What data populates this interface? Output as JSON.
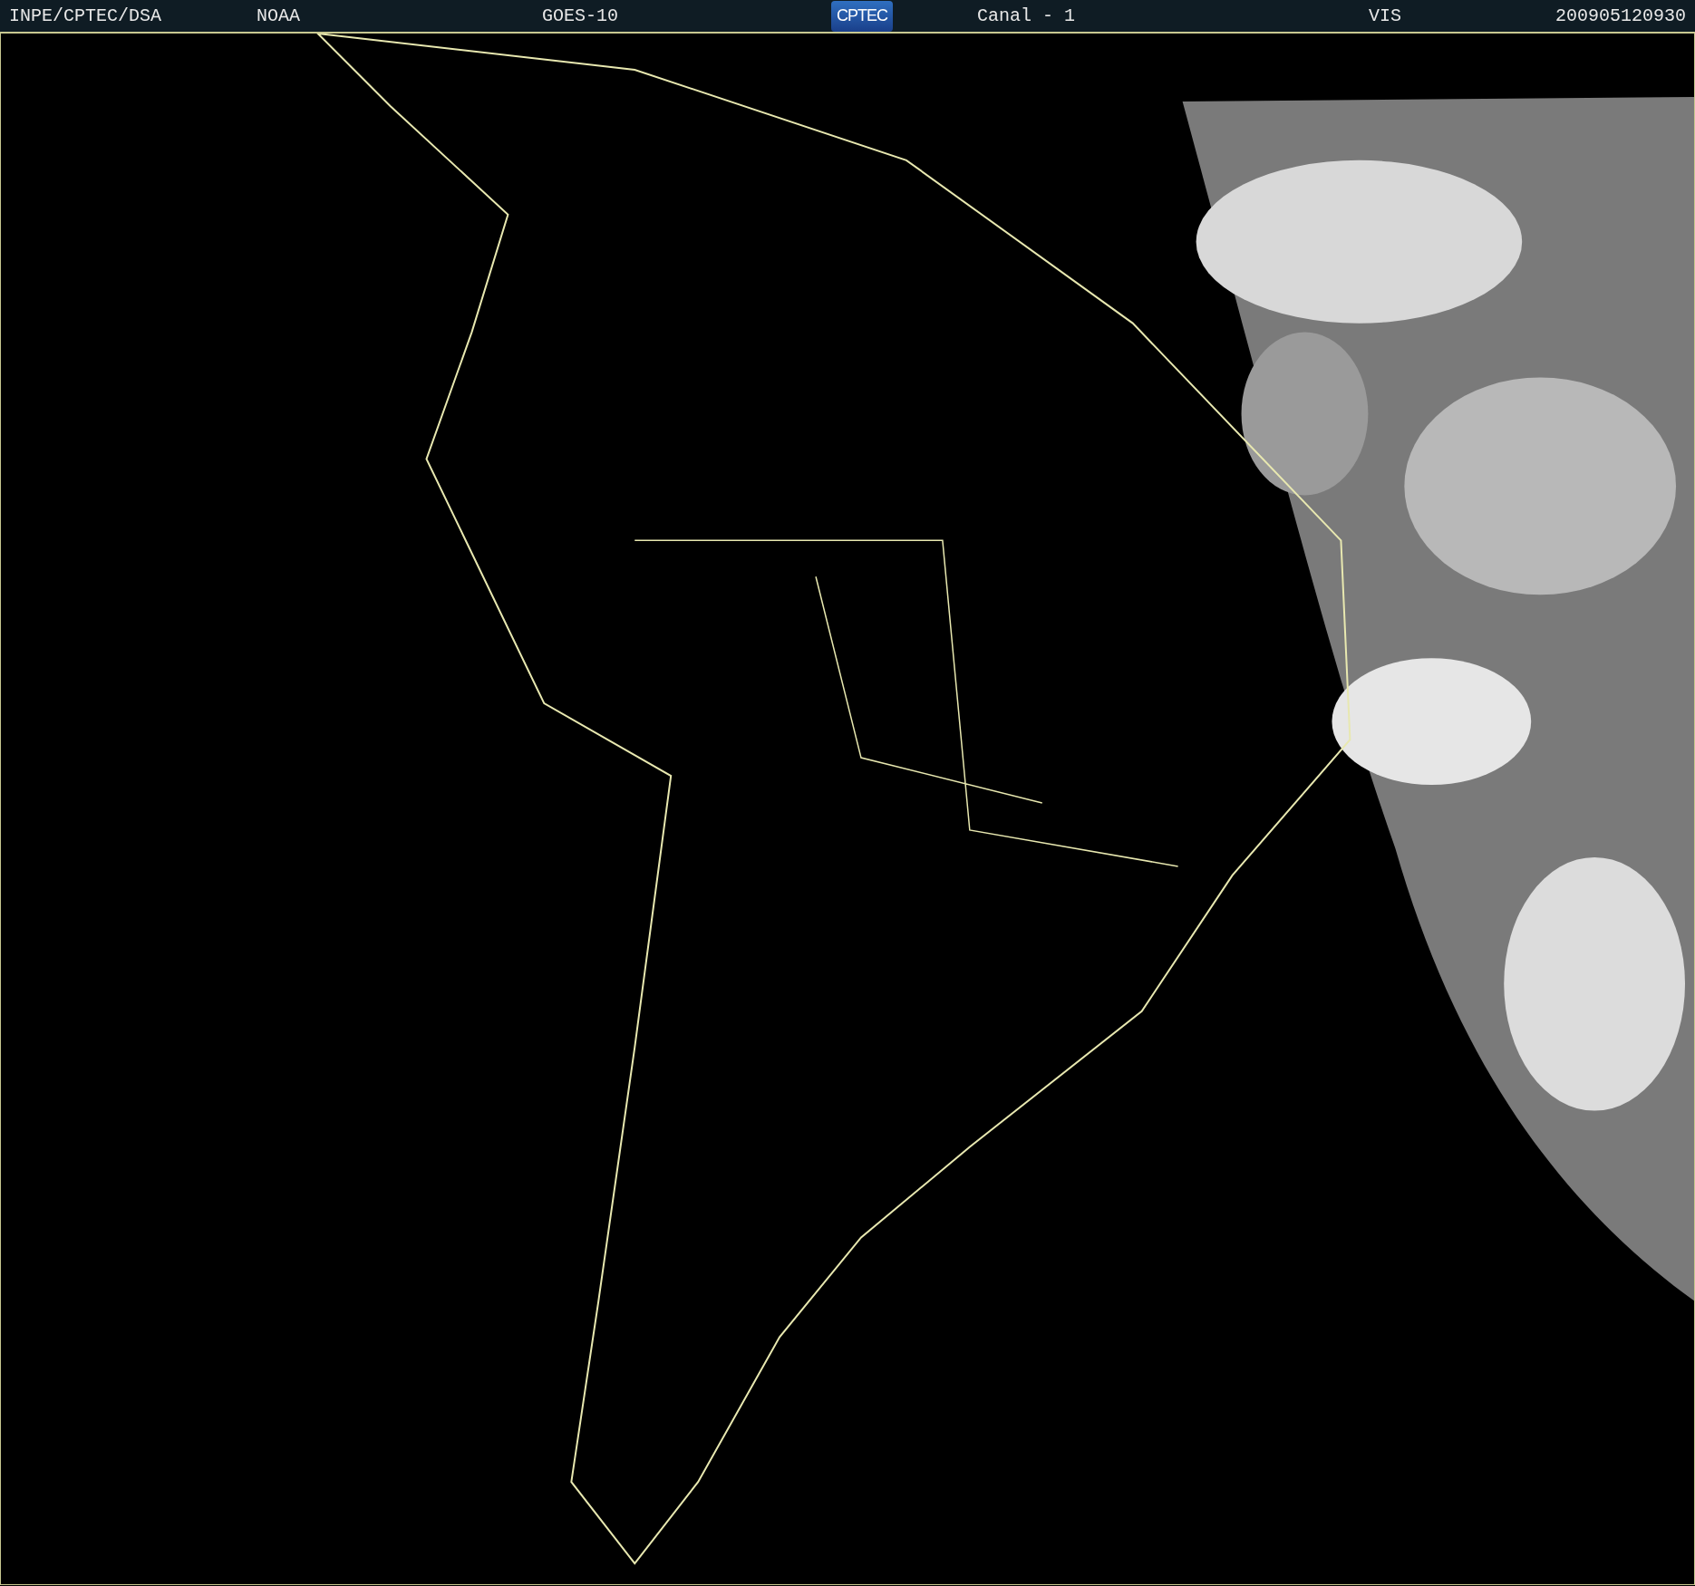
{
  "header": {
    "items": [
      {
        "kind": "text",
        "text": "INPE/CPTEC/DSA"
      },
      {
        "kind": "text",
        "text": "NOAA"
      },
      {
        "kind": "text",
        "text": "GOES-10"
      },
      {
        "kind": "logo",
        "text": "CPTEC"
      },
      {
        "kind": "text",
        "text": "Canal - 1"
      },
      {
        "kind": "text",
        "text": "VIS"
      },
      {
        "kind": "text",
        "text": "200905120930"
      }
    ]
  }
}
